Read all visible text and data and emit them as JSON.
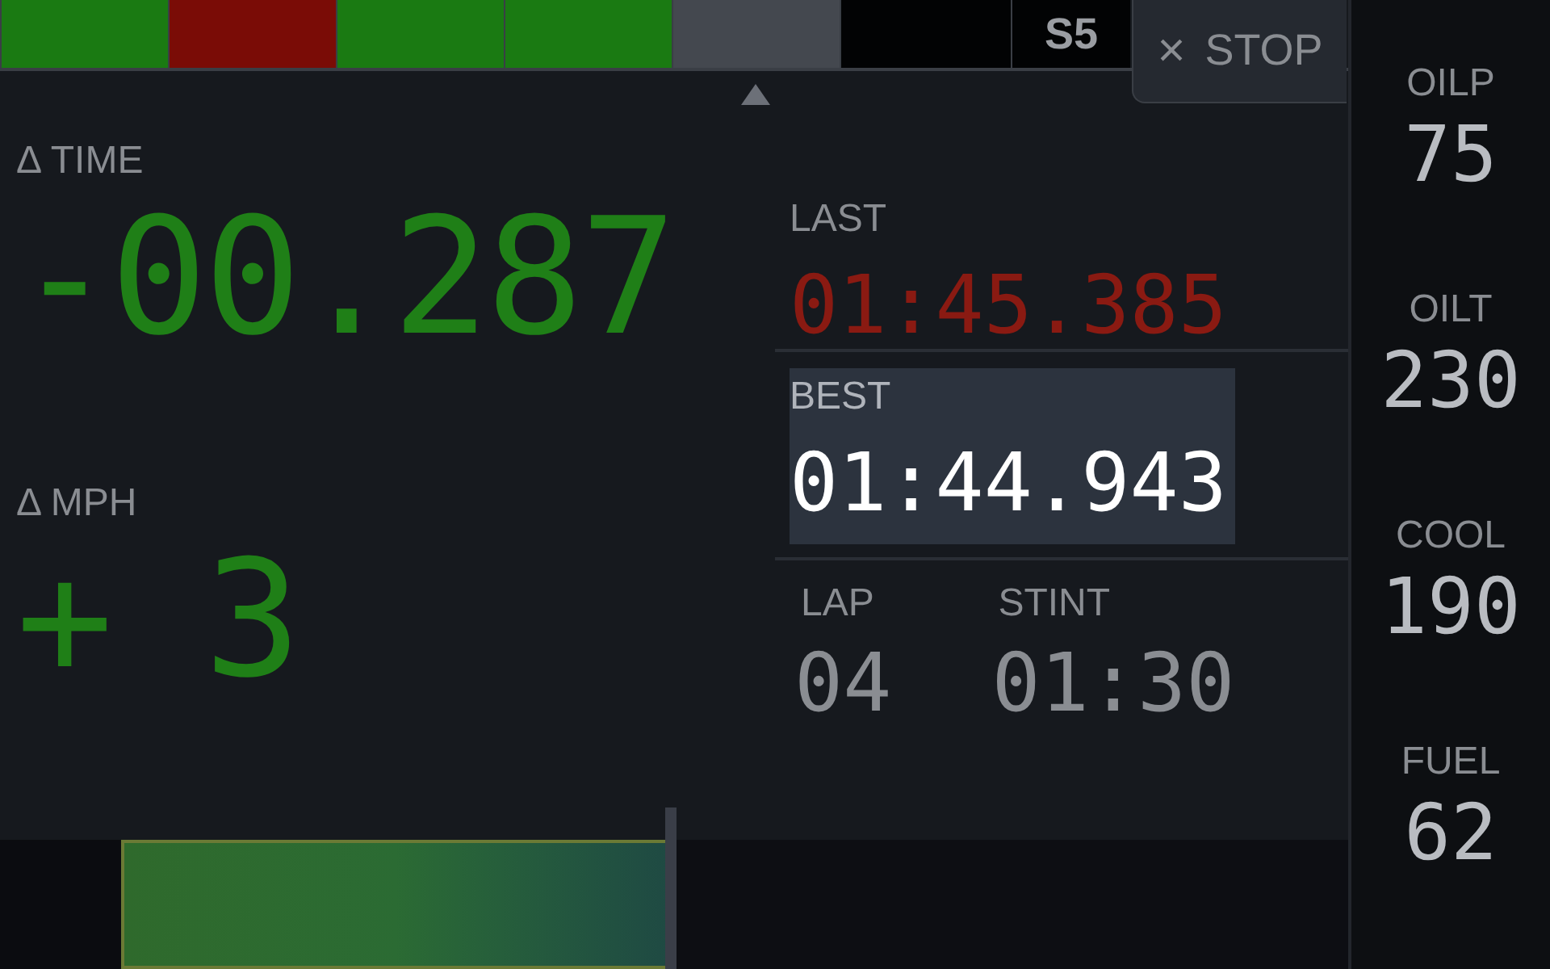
{
  "sectors": [
    {
      "color": "#1a7a12"
    },
    {
      "color": "#7a0c06"
    },
    {
      "color": "#1a7a12"
    },
    {
      "color": "#1a7a12"
    },
    {
      "color": "#44484f"
    },
    {
      "color": "#020304"
    },
    {
      "color": "#020304",
      "label": "S5"
    }
  ],
  "stop_button": {
    "icon": "×",
    "label": "STOP"
  },
  "deltas": [
    {
      "label": "Δ TIME",
      "value": "-00.287",
      "color": "#1f7f17"
    },
    {
      "label": "Δ MPH",
      "value": "+ 3",
      "color": "#1f7f17"
    }
  ],
  "lap_times": [
    {
      "label": "LAST",
      "value": "01:45.385",
      "color": "#8a1a12",
      "highlighted": false
    },
    {
      "label": "BEST",
      "value": "01:44.943",
      "color": "#ffffff",
      "highlighted": true
    }
  ],
  "counters": [
    {
      "label": "LAP",
      "value": "04"
    },
    {
      "label": "STINT",
      "value": "01:30"
    }
  ],
  "gauges": [
    {
      "label": "OILP",
      "value": "75"
    },
    {
      "label": "OILT",
      "value": "230"
    },
    {
      "label": "COOL",
      "value": "190"
    },
    {
      "label": "FUEL",
      "value": "62"
    }
  ],
  "delta_bar": {
    "level": 0.447
  }
}
